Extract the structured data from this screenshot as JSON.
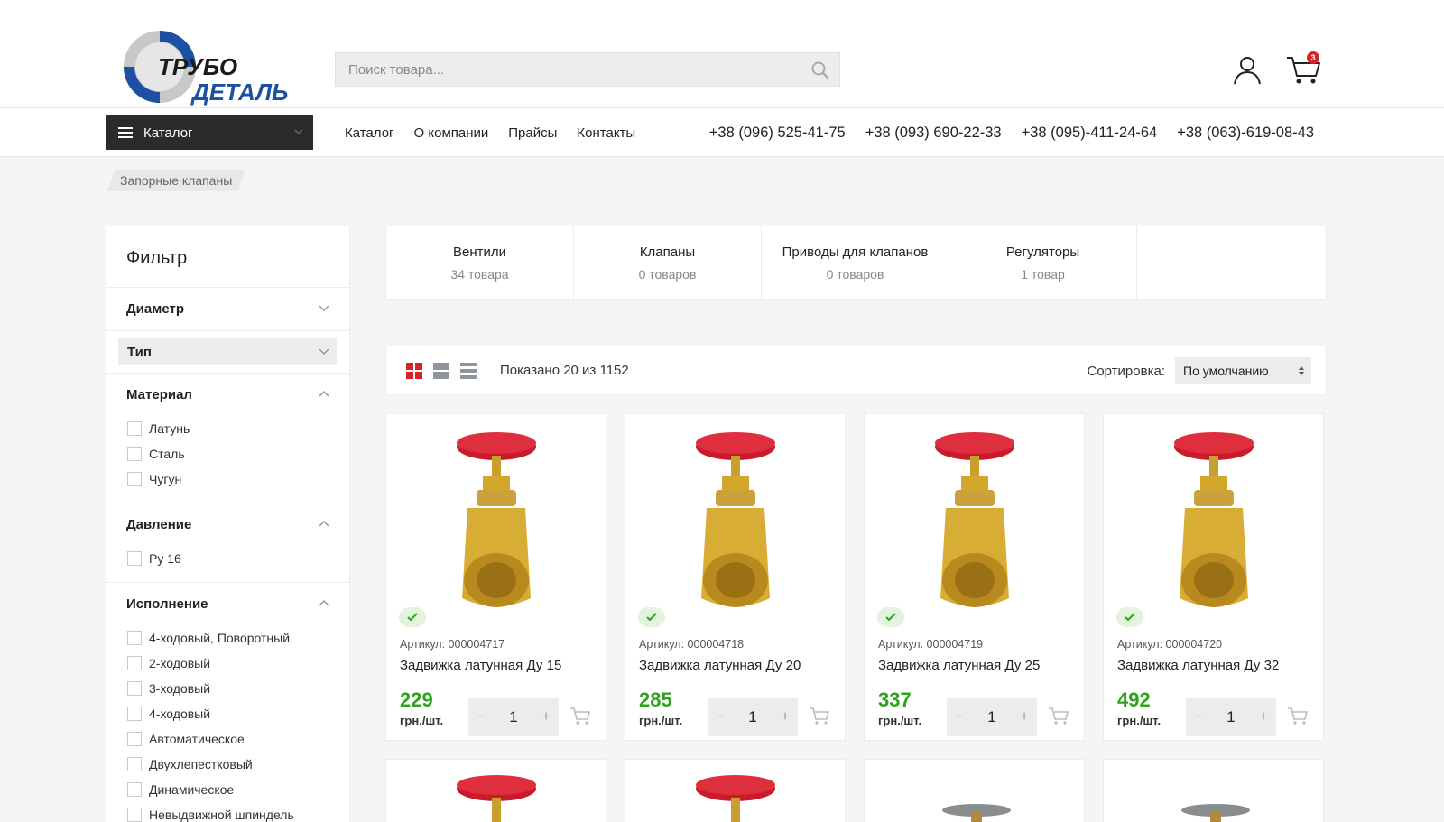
{
  "header": {
    "logo_line1": "ТРУБО",
    "logo_line2": "ДЕТАЛЬ",
    "search_placeholder": "Поиск товара...",
    "cart_count": "3"
  },
  "nav": {
    "catalog_button": "Каталог",
    "links": [
      "Каталог",
      "О компании",
      "Прайсы",
      "Контакты"
    ],
    "phones": [
      "+38 (096) 525-41-75",
      "+38 (093) 690-22-33",
      "+38 (095)-411-24-64",
      "+38 (063)-619-08-43"
    ]
  },
  "breadcrumb": "Запорные клапаны",
  "filter": {
    "title": "Фильтр",
    "sections": [
      {
        "name": "Диаметр",
        "items": []
      },
      {
        "name": "Тип",
        "items": []
      },
      {
        "name": "Материал",
        "items": [
          "Латунь",
          "Сталь",
          "Чугун"
        ]
      },
      {
        "name": "Давление",
        "items": [
          "Ру 16"
        ]
      },
      {
        "name": "Исполнение",
        "items": [
          "4-ходовый, Поворотный",
          "2-ходовый",
          "3-ходовый",
          "4-ходовый",
          "Автоматическое",
          "Двухлепестковый",
          "Динамическое",
          "Невыдвижной шпиндель"
        ]
      }
    ]
  },
  "subcategories": [
    {
      "name": "Вентили",
      "count": "34 товара"
    },
    {
      "name": "Клапаны",
      "count": "0 товаров"
    },
    {
      "name": "Приводы для клапанов",
      "count": "0 товаров"
    },
    {
      "name": "Регуляторы",
      "count": "1 товар"
    }
  ],
  "toolbar": {
    "shown": "Показано 20 из 1152",
    "sort_label": "Сортировка:",
    "sort_value": "По умолчанию"
  },
  "products": [
    {
      "sku": "Артикул: 000004717",
      "name": "Задвижка латунная Ду 15",
      "price": "229",
      "unit": "грн./шт.",
      "qty": "1"
    },
    {
      "sku": "Артикул: 000004718",
      "name": "Задвижка латунная Ду 20",
      "price": "285",
      "unit": "грн./шт.",
      "qty": "1"
    },
    {
      "sku": "Артикул: 000004719",
      "name": "Задвижка латунная Ду 25",
      "price": "337",
      "unit": "грн./шт.",
      "qty": "1"
    },
    {
      "sku": "Артикул: 000004720",
      "name": "Задвижка латунная Ду 32",
      "price": "492",
      "unit": "грн./шт.",
      "qty": "1"
    }
  ],
  "colors": {
    "accent": "#d8232a",
    "price": "#2ea31b",
    "dark": "#2b2b2b",
    "logo_blue": "#1d4fa3"
  },
  "icons": [
    "search-icon",
    "user-icon",
    "cart-icon",
    "menu-icon",
    "chevron-down-icon",
    "chevron-up-icon",
    "grid-view-icon",
    "list-view-icon",
    "compact-list-icon",
    "check-icon",
    "add-to-cart-icon"
  ]
}
